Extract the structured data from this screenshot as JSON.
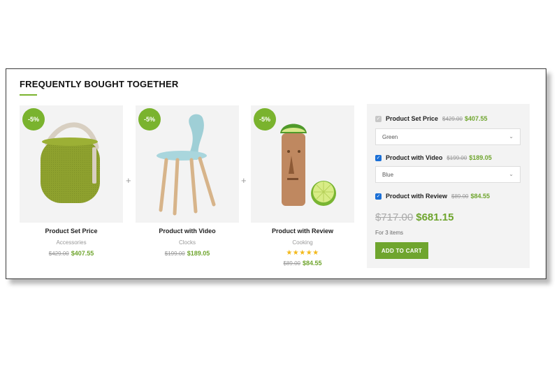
{
  "section": {
    "title": "FREQUENTLY BOUGHT TOGETHER"
  },
  "products": [
    {
      "badge": "-5%",
      "name": "Product Set Price",
      "category": "Accessories",
      "old_price": "$429.00",
      "price": "$407.55",
      "image": "green-stool"
    },
    {
      "badge": "-5%",
      "name": "Product with Video",
      "category": "Clocks",
      "old_price": "$199.00",
      "price": "$189.05",
      "image": "blue-chair"
    },
    {
      "badge": "-5%",
      "name": "Product with Review",
      "category": "Cooking",
      "old_price": "$89.00",
      "price": "$84.55",
      "image": "lime-juicer",
      "stars": "★★★★★"
    }
  ],
  "plus_sign": "+",
  "bundle": {
    "options": [
      {
        "name": "Product Set Price",
        "old_price": "$429.00",
        "price": "$407.55",
        "checked": true,
        "disabled": true,
        "select_value": "Green"
      },
      {
        "name": "Product with Video",
        "old_price": "$199.00",
        "price": "$189.05",
        "checked": true,
        "disabled": false,
        "select_value": "Blue"
      },
      {
        "name": "Product with Review",
        "old_price": "$89.00",
        "price": "$84.55",
        "checked": true,
        "disabled": false
      }
    ],
    "total_old": "$717.00",
    "total_new": "$681.15",
    "items_text": "For 3 items",
    "button_label": "ADD TO CART"
  },
  "colors": {
    "accent": "#6fa52e",
    "checkbox": "#1a6fd6",
    "star": "#f3b91b"
  }
}
